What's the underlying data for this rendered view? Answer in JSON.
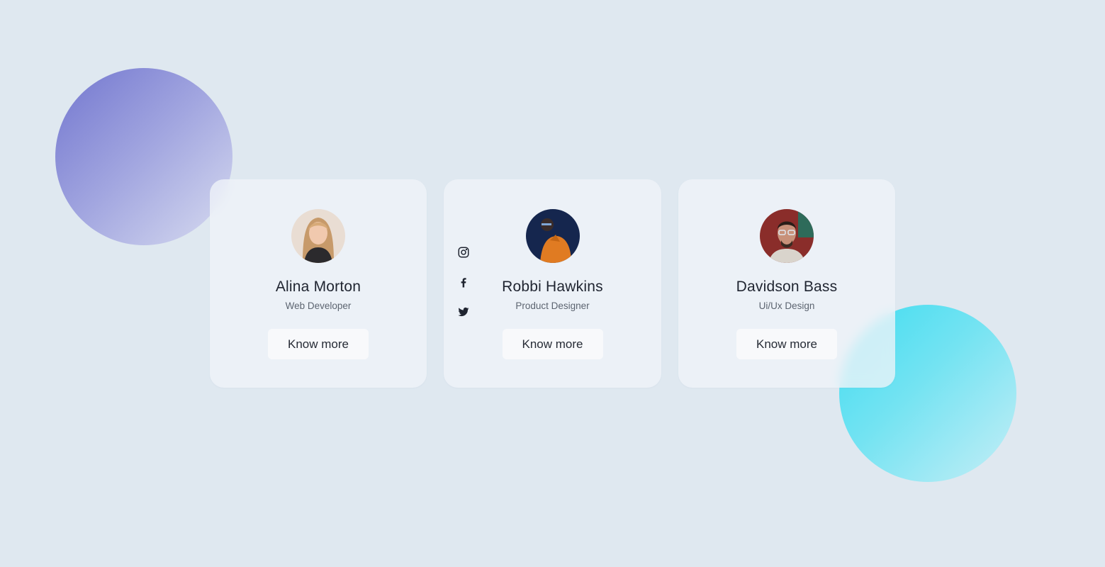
{
  "cards": [
    {
      "name": "Alina Morton",
      "role": "Web Developer",
      "button": "Know more",
      "avatar": "avatar-woman-blonde"
    },
    {
      "name": "Robbi Hawkins",
      "role": "Product Designer",
      "button": "Know more",
      "avatar": "avatar-man-orange-shirt",
      "socials": [
        "instagram-icon",
        "facebook-icon",
        "twitter-icon"
      ]
    },
    {
      "name": "Davidson Bass",
      "role": "Ui/Ux Design",
      "button": "Know more",
      "avatar": "avatar-man-glasses"
    }
  ],
  "colors": {
    "background": "#dfe8f0",
    "purple_blob": "#7276cf",
    "cyan_blob": "#3fdcf0",
    "text": "#1f2430"
  }
}
